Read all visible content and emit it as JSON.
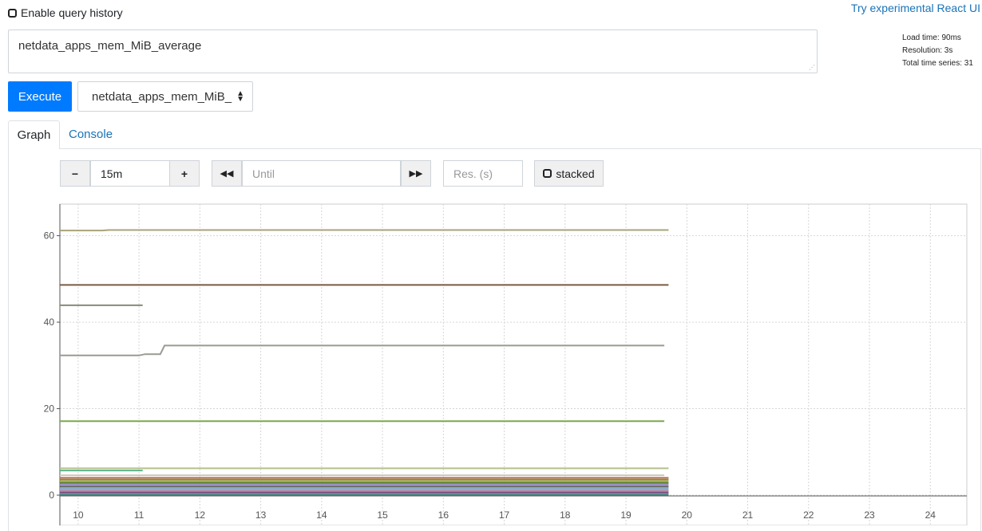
{
  "header": {
    "history_label": "Enable query history",
    "react_link": "Try experimental React UI"
  },
  "query": {
    "expression": "netdata_apps_mem_MiB_average",
    "resize_grip": "⋰"
  },
  "stats": {
    "load_time": "Load time: 90ms",
    "resolution": "Resolution: 3s",
    "total_series": "Total time series: 31"
  },
  "toolbar": {
    "execute_label": "Execute",
    "metric_select_value": "netdata_apps_mem_MiB_",
    "caret_up": "▲",
    "caret_down": "▼"
  },
  "tabs": [
    {
      "label": "Graph"
    },
    {
      "label": "Console"
    }
  ],
  "graph_controls": {
    "minus": "−",
    "range": "15m",
    "plus": "+",
    "back": "◀◀",
    "until_placeholder": "Until",
    "forward": "▶▶",
    "res_placeholder": "Res. (s)",
    "stacked_label": "stacked"
  },
  "chart_data": {
    "type": "line",
    "x_tick_labels": [
      "10",
      "11",
      "12",
      "13",
      "14",
      "15",
      "16",
      "17",
      "18",
      "19",
      "20",
      "21",
      "22",
      "23",
      "24"
    ],
    "xlim": [
      9.7,
      24.6
    ],
    "y_ticks": [
      0,
      20,
      40,
      60
    ],
    "ylim": [
      -7,
      67.3
    ],
    "grid": true,
    "series": [
      {
        "color": "#a8a37a",
        "points": [
          [
            9.7,
            61.2
          ],
          [
            10.4,
            61.2
          ],
          [
            10.5,
            61.3
          ],
          [
            19.7,
            61.3
          ]
        ]
      },
      {
        "color": "#7a5a43",
        "points": [
          [
            9.7,
            48.6
          ],
          [
            19.7,
            48.6
          ]
        ]
      },
      {
        "color": "#8a8a78",
        "points": [
          [
            9.7,
            43.9
          ],
          [
            11.06,
            43.9
          ]
        ]
      },
      {
        "color": "#9a9a92",
        "points": [
          [
            9.7,
            32.3
          ],
          [
            11.0,
            32.3
          ],
          [
            11.1,
            32.6
          ],
          [
            11.35,
            32.6
          ],
          [
            11.42,
            34.6
          ],
          [
            19.63,
            34.6
          ]
        ]
      },
      {
        "color": "#7ba84a",
        "points": [
          [
            9.7,
            17.1
          ],
          [
            19.63,
            17.1
          ]
        ]
      },
      {
        "color": "#b3c08a",
        "points": [
          [
            9.7,
            6.2
          ],
          [
            19.7,
            6.2
          ]
        ]
      },
      {
        "color": "#5fb38a",
        "points": [
          [
            9.7,
            5.7
          ],
          [
            11.06,
            5.7
          ]
        ]
      },
      {
        "color": "#c9c9b8",
        "points": [
          [
            9.7,
            4.6
          ],
          [
            19.63,
            4.6
          ]
        ]
      },
      {
        "color": "#d06a5a",
        "points": [
          [
            9.7,
            4.0
          ],
          [
            19.7,
            4.0
          ]
        ]
      },
      {
        "color": "#6e8f3c",
        "points": [
          [
            9.7,
            3.6
          ],
          [
            19.7,
            3.6
          ]
        ]
      },
      {
        "color": "#b7a23c",
        "points": [
          [
            9.7,
            3.2
          ],
          [
            19.7,
            3.2
          ]
        ]
      },
      {
        "color": "#4c7a2a",
        "points": [
          [
            9.7,
            2.8
          ],
          [
            19.7,
            2.8
          ]
        ]
      },
      {
        "color": "#9a8fc9",
        "points": [
          [
            9.7,
            2.4
          ],
          [
            19.7,
            2.4
          ]
        ]
      },
      {
        "color": "#5f5f5f",
        "points": [
          [
            9.7,
            2.0
          ],
          [
            19.7,
            2.0
          ]
        ]
      },
      {
        "color": "#7fa9c9",
        "points": [
          [
            9.7,
            1.6
          ],
          [
            19.7,
            1.6
          ]
        ]
      },
      {
        "color": "#a0a0a0",
        "points": [
          [
            9.7,
            1.2
          ],
          [
            19.7,
            1.2
          ]
        ]
      },
      {
        "color": "#c97fb4",
        "points": [
          [
            9.7,
            0.9
          ],
          [
            19.7,
            0.9
          ]
        ]
      },
      {
        "color": "#6a4a8a",
        "points": [
          [
            9.7,
            0.6
          ],
          [
            19.7,
            0.6
          ]
        ]
      },
      {
        "color": "#c97a6a",
        "points": [
          [
            9.7,
            0.3
          ],
          [
            19.7,
            0.3
          ]
        ]
      },
      {
        "color": "#3a8a8a",
        "points": [
          [
            9.7,
            0.1
          ],
          [
            19.7,
            0.1
          ]
        ]
      }
    ]
  }
}
